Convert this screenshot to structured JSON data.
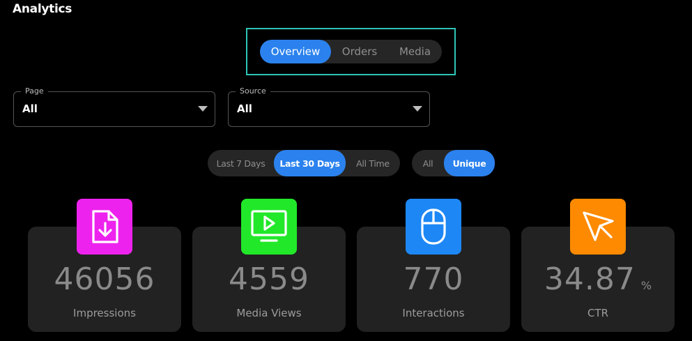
{
  "page": {
    "title": "Analytics"
  },
  "main_tabs": {
    "items": [
      "Overview",
      "Orders",
      "Media"
    ],
    "active": "Overview"
  },
  "filters": {
    "page": {
      "label": "Page",
      "value": "All"
    },
    "source": {
      "label": "Source",
      "value": "All"
    }
  },
  "date_range": {
    "items": [
      "Last 7 Days",
      "Last 30 Days",
      "All Time"
    ],
    "active": "Last 30 Days"
  },
  "uniqueness": {
    "items": [
      "All",
      "Unique"
    ],
    "active": "Unique"
  },
  "stats": [
    {
      "value": "46056",
      "unit": "",
      "label": "Impressions",
      "icon": "document-download-icon",
      "color": "#ee22ee"
    },
    {
      "value": "4559",
      "unit": "",
      "label": "Media Views",
      "icon": "monitor-play-icon",
      "color": "#22e82a"
    },
    {
      "value": "770",
      "unit": "",
      "label": "Interactions",
      "icon": "mouse-icon",
      "color": "#1d87f5"
    },
    {
      "value": "34.87",
      "unit": "%",
      "label": "CTR",
      "icon": "cursor-arrow-icon",
      "color": "#fd8a00"
    }
  ],
  "colors": {
    "accent": "#2b82ee",
    "highlight_border": "#2ec4b6",
    "background": "#000000",
    "card": "#222222"
  }
}
